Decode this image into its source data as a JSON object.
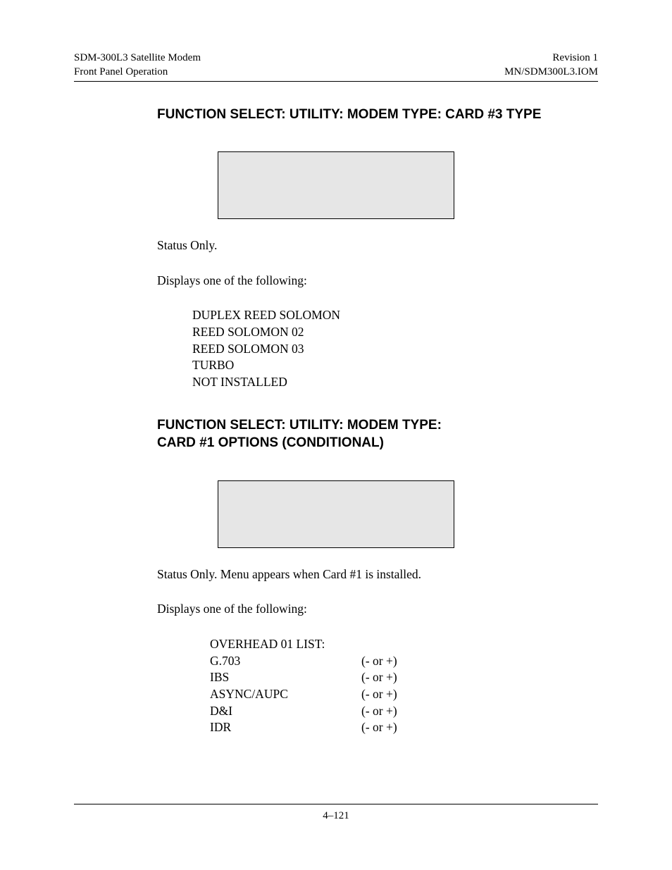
{
  "header": {
    "left_line1": "SDM-300L3 Satellite Modem",
    "left_line2": "Front Panel Operation",
    "right_line1": "Revision 1",
    "right_line2": "MN/SDM300L3.IOM"
  },
  "section1": {
    "heading": "FUNCTION SELECT: UTILITY: MODEM TYPE: CARD #3 TYPE",
    "status_text": "Status Only.",
    "displays_text": "Displays one of the following:",
    "items": [
      "DUPLEX REED SOLOMON",
      "REED SOLOMON 02",
      "REED SOLOMON 03",
      "TURBO",
      "NOT INSTALLED"
    ]
  },
  "section2": {
    "heading_line1": "FUNCTION SELECT: UTILITY: MODEM TYPE:",
    "heading_line2": "CARD #1 OPTIONS (CONDITIONAL)",
    "status_text": "Status Only. Menu appears when Card #1 is installed.",
    "displays_text": "Displays one of the following:",
    "list_header": "OVERHEAD 01 LIST:",
    "options": [
      {
        "name": "G.703",
        "suffix": "(- or +)"
      },
      {
        "name": "IBS",
        "suffix": "(- or +)"
      },
      {
        "name": "ASYNC/AUPC",
        "suffix": "(- or +)"
      },
      {
        "name": "D&I",
        "suffix": "(- or +)"
      },
      {
        "name": "IDR",
        "suffix": "(- or +)"
      }
    ]
  },
  "footer": {
    "page_number": "4–121"
  }
}
